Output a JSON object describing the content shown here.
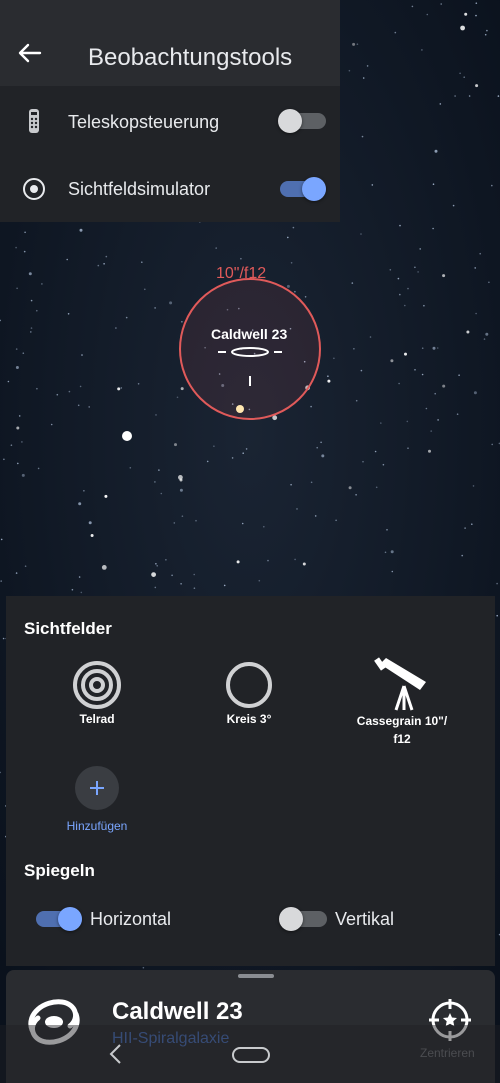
{
  "header": {
    "title": "Beobachtungstools"
  },
  "tools": [
    {
      "label": "Teleskopsteuerung",
      "enabled": false
    },
    {
      "label": "Sichtfeldsimulator",
      "enabled": true
    }
  ],
  "map": {
    "fov_label": "10\"/f12",
    "object_label": "Caldwell 23"
  },
  "fields_of_view": {
    "title": "Sichtfelder",
    "items": [
      {
        "label": "Telrad",
        "icon": "telrad-icon"
      },
      {
        "label": "Kreis 3°",
        "icon": "circle-icon"
      },
      {
        "label_line1": "Cassegrain 10\"/",
        "label_line2": "f12",
        "icon": "telescope-icon"
      }
    ],
    "add_label": "Hinzufügen"
  },
  "mirror": {
    "title": "Spiegeln",
    "horizontal": {
      "label": "Horizontal",
      "enabled": true
    },
    "vertical": {
      "label": "Vertikal",
      "enabled": false
    }
  },
  "object": {
    "name": "Caldwell 23",
    "type": "HII-Spiralgalaxie",
    "center_label": "Zentrieren"
  },
  "colors": {
    "accent": "#7aa6ff",
    "track_on": "#4f6fb0",
    "fov_circle": "#e05a5a",
    "panel": "#212327"
  }
}
